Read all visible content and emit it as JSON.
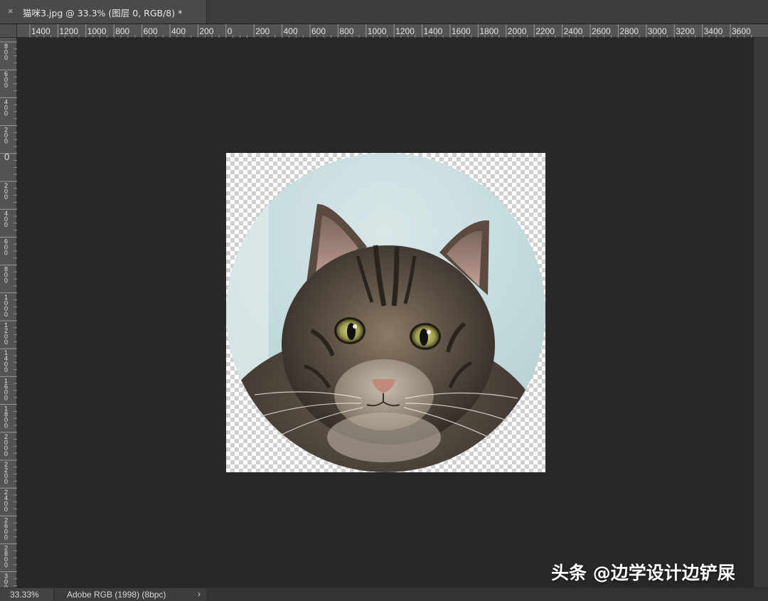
{
  "tab": {
    "close_glyph": "×",
    "title": "猫咪3.jpg @ 33.3% (图层 0, RGB/8) *"
  },
  "ruler": {
    "horizontal_labels": [
      "1400",
      "1200",
      "1000",
      "800",
      "600",
      "400",
      "200",
      "0",
      "200",
      "400",
      "600",
      "800",
      "1000",
      "1200",
      "1400",
      "1600",
      "1800",
      "2000",
      "2200",
      "2400",
      "2600",
      "2800",
      "3000",
      "3200",
      "3400",
      "3600"
    ],
    "vertical_labels": [
      "800",
      "600",
      "400",
      "200",
      "0",
      "200",
      "400",
      "600",
      "800",
      "1000",
      "1200",
      "1400",
      "1600",
      "1800",
      "2000",
      "2200",
      "2400",
      "2600",
      "2800",
      "3000"
    ]
  },
  "canvas": {
    "image_subject": "tabby cat face in circular mask on transparent background"
  },
  "watermark": {
    "text": "头条 @边学设计边铲屎"
  },
  "statusbar": {
    "zoom": "33.33%",
    "doc_info": "Adobe RGB (1998) (8bpc)",
    "arrow_glyph": "›"
  },
  "colors": {
    "canvas_bg": "#282828",
    "ruler_bg": "#535353",
    "tab_bg": "#4a4a4a"
  }
}
